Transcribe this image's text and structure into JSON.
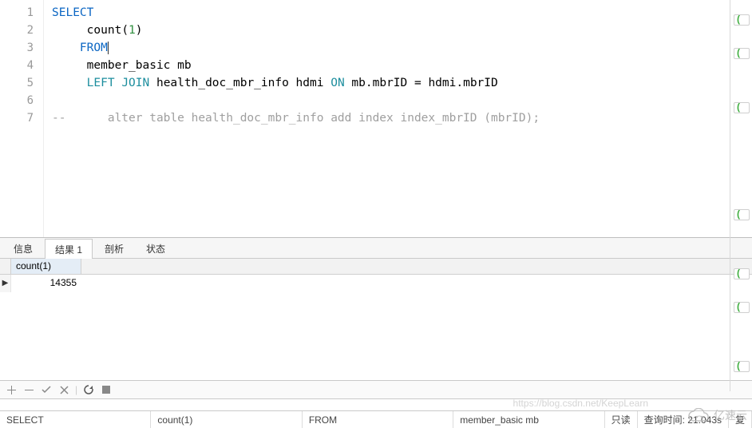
{
  "editor": {
    "lines": [
      {
        "n": "1",
        "tokens": [
          {
            "t": "SELECT",
            "c": "kw-blue"
          }
        ]
      },
      {
        "n": "2",
        "tokens": [
          {
            "t": "     count",
            "c": ""
          },
          {
            "t": "(",
            "c": ""
          },
          {
            "t": "1",
            "c": "kw-green"
          },
          {
            "t": ")",
            "c": ""
          }
        ]
      },
      {
        "n": "3",
        "tokens": [
          {
            "t": "    ",
            "c": ""
          },
          {
            "t": "FROM",
            "c": "kw-blue"
          }
        ]
      },
      {
        "n": "4",
        "tokens": [
          {
            "t": "     member_basic mb",
            "c": ""
          }
        ]
      },
      {
        "n": "5",
        "tokens": [
          {
            "t": "     ",
            "c": ""
          },
          {
            "t": "LEFT",
            "c": "kw-cyan"
          },
          {
            "t": " ",
            "c": ""
          },
          {
            "t": "JOIN",
            "c": "kw-cyan"
          },
          {
            "t": " health_doc_mbr_info hdmi ",
            "c": ""
          },
          {
            "t": "ON",
            "c": "kw-cyan"
          },
          {
            "t": " mb.mbrID = hdmi.mbrID",
            "c": ""
          }
        ]
      },
      {
        "n": "6",
        "tokens": []
      },
      {
        "n": "7",
        "tokens": [
          {
            "t": "--      alter table health_doc_mbr_info add index index_mbrID (mbrID);",
            "c": "comment"
          }
        ]
      }
    ]
  },
  "tabs": {
    "items": [
      {
        "label": "信息",
        "active": false
      },
      {
        "label": "结果 1",
        "active": true
      },
      {
        "label": "剖析",
        "active": false
      },
      {
        "label": "状态",
        "active": false
      }
    ]
  },
  "result": {
    "columns": [
      "count(1)"
    ],
    "rows": [
      [
        "14355"
      ]
    ]
  },
  "statusbar": {
    "c1": "SELECT",
    "c2": "count(1)",
    "c3": "FROM",
    "c4": "member_basic mb",
    "c5": "只读",
    "c6": "查询时间: 21.043s",
    "c7": "复"
  },
  "watermark": {
    "text": "亿速云"
  },
  "ghost_url": "https://blog.csdn.net/KeepLearn"
}
